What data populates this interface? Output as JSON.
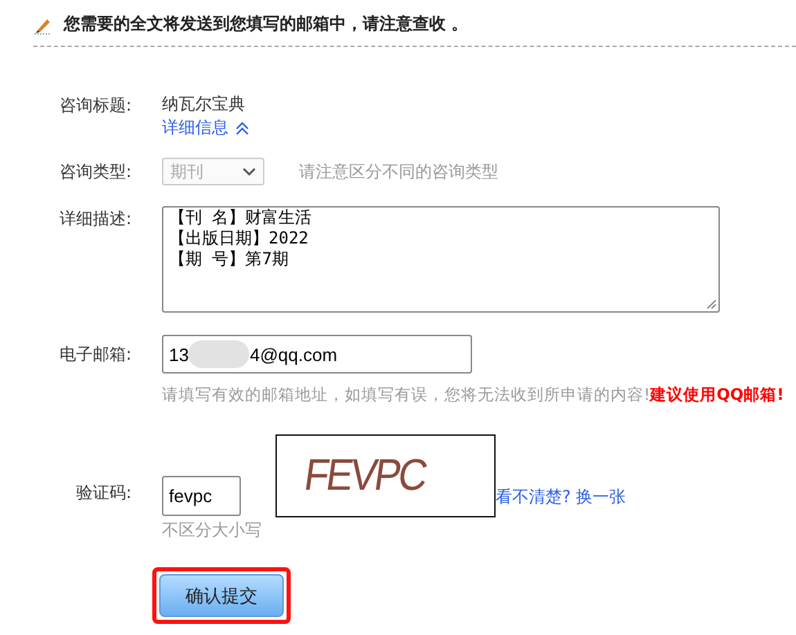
{
  "notice": {
    "text": "您需要的全文将发送到您填写的邮箱中，请注意查收 。"
  },
  "form": {
    "title": {
      "label": "咨询标题:",
      "value": "纳瓦尔宝典",
      "details_link": "详细信息",
      "expanded": true
    },
    "type": {
      "label": "咨询类型:",
      "value": "期刊",
      "disabled": true,
      "hint": "请注意区分不同的咨询类型"
    },
    "description": {
      "label": "详细描述:",
      "lines": [
        "【刊 名】财富生活",
        "【出版日期】2022",
        "【期 号】第7期"
      ]
    },
    "email": {
      "label": "电子邮箱:",
      "value_start": "13",
      "value_end": "4@qq.com",
      "blurred": true,
      "hint": "请填写有效的邮箱地址，如填写有误，您将无法收到所申请的内容!",
      "hint_emphasis": "建议使用QQ邮箱!"
    },
    "captcha": {
      "label": "验证码:",
      "value": "fevpc",
      "image_text": "FEVPC",
      "refresh_link": "看不清楚? 换一张",
      "hint": "不区分大小写"
    },
    "submit": {
      "label": "确认提交",
      "highlighted": true
    }
  }
}
